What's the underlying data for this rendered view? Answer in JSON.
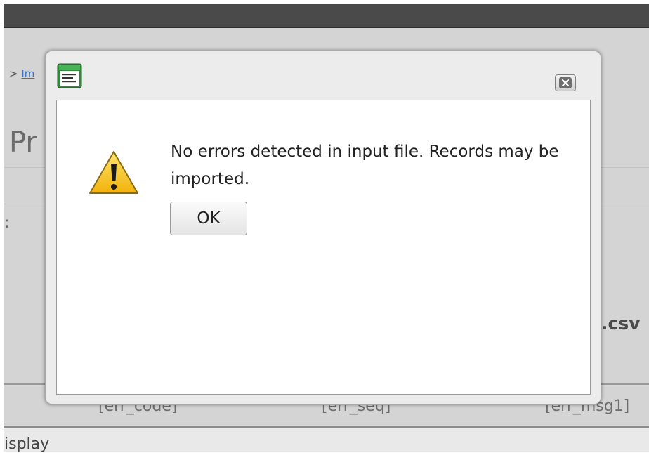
{
  "background": {
    "breadcrumb_separator": ">",
    "breadcrumb_link": "Im",
    "page_title": "Pr",
    "field_label": ":",
    "file_extension": ".csv",
    "table_columns": [
      "[err_code]",
      "[err_seq]",
      "[err_msg1]"
    ],
    "footer_text": "isplay"
  },
  "dialog": {
    "icon": "app-window-icon",
    "close_icon": "close-icon",
    "warning_icon": "warning-icon",
    "message": "No errors detected in input file. Records may be imported.",
    "ok_label": "OK"
  },
  "colors": {
    "top_bar": "#4a4a4a",
    "page_background": "#d4d4d4",
    "link": "#3b73c4",
    "warning_fill": "#f6c21a"
  }
}
